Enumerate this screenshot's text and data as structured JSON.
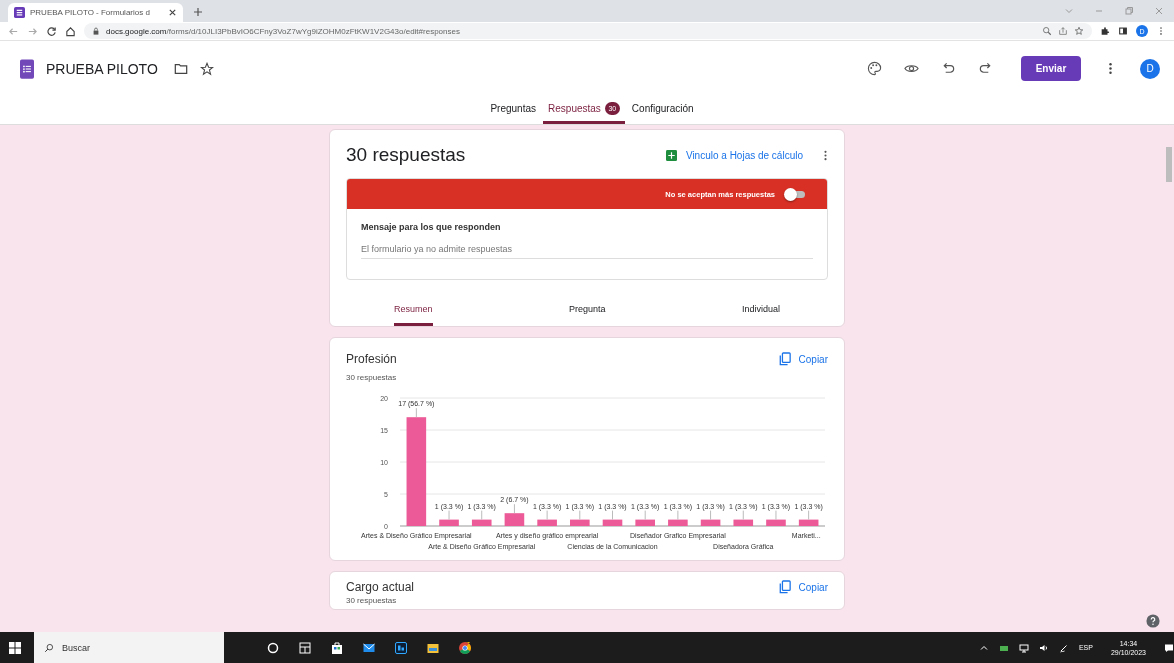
{
  "browser": {
    "tab_title": "PRUEBA PILOTO - Formularios d",
    "url_host": "docs.google.com",
    "url_path": "/forms/d/10JLI3PbBvIO6CFny3VoZ7wYg9iZOHM0zFtKW1V2G43o/edit#responses",
    "profile_initial": "D"
  },
  "header": {
    "title": "PRUEBA PILOTO",
    "send_button": "Enviar",
    "avatar_initial": "D"
  },
  "tabs": [
    {
      "label": "Preguntas",
      "selected": false
    },
    {
      "label": "Respuestas",
      "badge": "30",
      "selected": true
    },
    {
      "label": "Configuración",
      "selected": false
    }
  ],
  "summary": {
    "title": "30 respuestas",
    "sheets_link": "Vinculo a Hojas de cálculo",
    "banner": "No se aceptan más respuestas",
    "accepting": false,
    "message_label": "Mensaje para los que responden",
    "message_value": "El formulario ya no admite respuestas",
    "views": [
      {
        "label": "Resumen",
        "selected": true
      },
      {
        "label": "Pregunta",
        "selected": false
      },
      {
        "label": "Individual",
        "selected": false
      }
    ]
  },
  "questions": [
    {
      "title": "Profesión",
      "count": "30 respuestas",
      "copy": "Copiar",
      "chart_data": {
        "type": "bar",
        "categories": [
          "Artes & Diseño Gráfico Empresarial",
          null,
          "Arte & Diseño Gráfico Empresarial",
          null,
          "Artes y diseño gráfico emprearial",
          null,
          "Ciencias de la Comunicacion",
          null,
          "Diseñador Grafico Empresarial",
          null,
          "Diseñadora Gráfica",
          null,
          "Marketi..."
        ],
        "grid": true,
        "series": [
          {
            "color": "#ec5b97",
            "values": [
              17,
              1,
              1,
              2,
              1,
              1,
              1,
              1,
              1,
              1,
              1,
              1,
              1
            ]
          }
        ],
        "ylim": [
          0,
          20
        ],
        "yticks": [
          0,
          5,
          10,
          15,
          20
        ],
        "value_labels": [
          "17 (56.7 %)",
          "1 (3.3 %)",
          "1 (3.3 %)",
          "2 (6.7 %)",
          "1 (3.3 %)",
          "1 (3.3 %)",
          "1 (3.3 %)",
          "1 (3.3 %)",
          "1 (3.3 %)",
          "1 (3.3 %)",
          "1 (3.3 %)",
          "1 (3.3 %)",
          "1 (3.3 %)"
        ]
      }
    },
    {
      "title": "Cargo actual",
      "count": "30 respuestas",
      "copy": "Copiar"
    }
  ],
  "taskbar": {
    "search_placeholder": "Buscar",
    "language": "ESP",
    "time": "14:34",
    "date": "29/10/2023"
  }
}
